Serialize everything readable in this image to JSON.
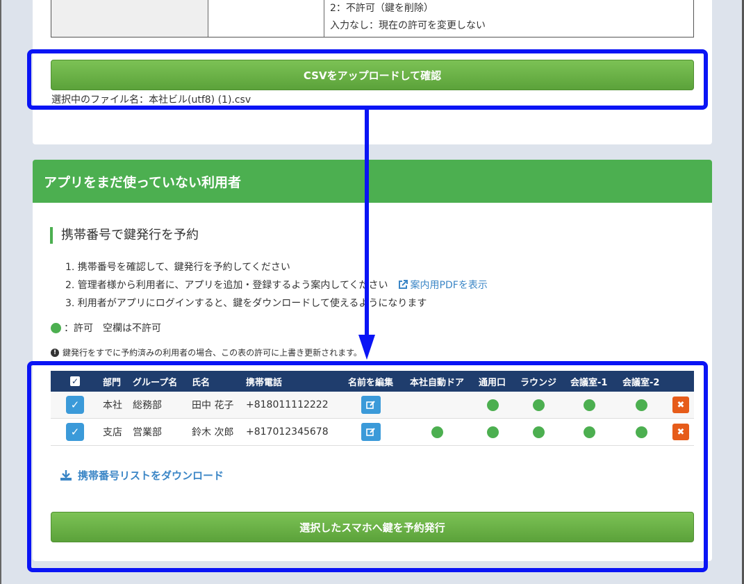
{
  "desc_table": {
    "line1": "2：不許可（鍵を削除）",
    "line2": "入力なし：現在の許可を変更しない"
  },
  "upload": {
    "button_label": "CSVをアップロードして確認",
    "filename_text": "選択中のファイル名：本社ビル(utf8) (1).csv"
  },
  "card": {
    "header_title": "アプリをまだ使っていない利用者",
    "section_title": "携帯番号で鍵発行を予約",
    "steps": [
      "1. 携帯番号を確認して、鍵発行を予約してください",
      "2. 管理者様から利用者に、アプリを追加・登録するよう案内してください",
      "3. 利用者がアプリにログインすると、鍵をダウンロードして使えるようになります"
    ],
    "pdf_link": "案内用PDFを表示",
    "legend_text": "：許可　空欄は不許可",
    "warning": "鍵発行をすでに予約済みの利用者の場合、この表の許可に上書き更新されます。"
  },
  "table": {
    "headers": {
      "dept": "部門",
      "group": "グループ名",
      "name": "氏名",
      "phone": "携帯電話",
      "edit": "名前を編集",
      "door": "本社自動ドア",
      "gate": "通用口",
      "lounge": "ラウンジ",
      "room1": "会議室-1",
      "room2": "会議室-2"
    },
    "rows": [
      {
        "dept": "本社",
        "group": "総務部",
        "name": "田中 花子",
        "phone": "+818011112222",
        "door": false,
        "gate": true,
        "lounge": true,
        "room1": true,
        "room2": true
      },
      {
        "dept": "支店",
        "group": "営業部",
        "name": "鈴木 次郎",
        "phone": "+817012345678",
        "door": true,
        "gate": true,
        "lounge": true,
        "room1": true,
        "room2": true
      }
    ]
  },
  "download_link": "携帯番号リストをダウンロード",
  "submit_button": "選択したスマホへ鍵を予約発行",
  "colors": {
    "accent_green": "#4caf50",
    "header_navy": "#1f3d6d",
    "highlight_blue": "#0a14f5",
    "delete_orange": "#e65c1a"
  }
}
